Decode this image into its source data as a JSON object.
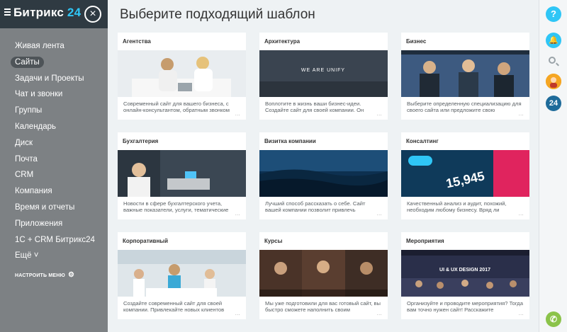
{
  "sidebar": {
    "logo_text": "Битрикс",
    "logo_num": "24",
    "close_glyph": "×",
    "items": [
      {
        "label": "Живая лента"
      },
      {
        "label": "Сайты"
      },
      {
        "label": "Задачи и Проекты"
      },
      {
        "label": "Чат и звонки"
      },
      {
        "label": "Группы"
      },
      {
        "label": "Календарь"
      },
      {
        "label": "Диск"
      },
      {
        "label": "Почта"
      },
      {
        "label": "CRM"
      },
      {
        "label": "Компания"
      },
      {
        "label": "Время и отчеты"
      },
      {
        "label": "Приложения"
      },
      {
        "label": "1С + CRM Битрикс24"
      },
      {
        "label": "Ещё ˅"
      }
    ],
    "active_index": 1,
    "settings_label": "НАСТРОИТЬ МЕНЮ",
    "settings_icon": "⚙"
  },
  "main": {
    "title": "Выберите подходящий шаблон",
    "cards": [
      {
        "title": "Агентства",
        "desc": "Современный сайт для вашего бизнеса, с онлайн-консультантом, обратным звонком"
      },
      {
        "title": "Архитектура",
        "desc": "Воплотите в жизнь ваши бизнес-идеи. Создайте сайт для своей компании. Он",
        "img_text": "WE ARE UNIFY"
      },
      {
        "title": "Бизнес",
        "desc": "Выберите определенную специализацию для своего сайта или предложите свою"
      },
      {
        "title": "Бухгалтерия",
        "desc": "Новости в сфере бухгалтерского учета, важные показатели, услуги, тематические"
      },
      {
        "title": "Визитка компании",
        "desc": "Лучший способ рассказать о себе. Сайт вашей компании позволит привлечь"
      },
      {
        "title": "Консалтинг",
        "desc": "Качественный анализ и аудит, похожий, необходим любому бизнесу. Вряд ли",
        "img_text": "15,945"
      },
      {
        "title": "Корпоративный",
        "desc": "Создайте современный сайт для своей компании. Привлекайте новых клиентов"
      },
      {
        "title": "Курсы",
        "desc": "Мы уже подготовили для вас готовый сайт, вы быстро сможете наполнить своим"
      },
      {
        "title": "Мероприятия",
        "desc": "Организуйте и проводите мероприятия? Тогда вам точно нужен сайт! Расскажите",
        "img_text": "UI & UX DESIGN 2017"
      }
    ],
    "dots": "…"
  },
  "rail": {
    "help_glyph": "?",
    "bell_glyph": "🔔",
    "b24_label": "24",
    "phone_glyph": "✆"
  },
  "colors": {
    "sidebar_bg": "#7d8184",
    "header_bg": "#2f3a42",
    "accent": "#2fc6f6",
    "main_bg": "#eef2f4"
  }
}
